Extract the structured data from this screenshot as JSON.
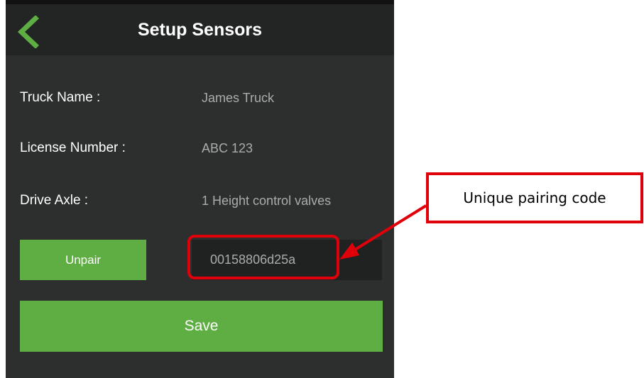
{
  "header": {
    "title": "Setup Sensors",
    "back_icon": "chevron-left-icon"
  },
  "fields": [
    {
      "label": "Truck Name :",
      "value": "James Truck"
    },
    {
      "label": "License Number :",
      "value": "ABC 123"
    },
    {
      "label": "Drive Axle :",
      "value": "1 Height control valves"
    }
  ],
  "pairing": {
    "unpair_label": "Unpair",
    "code": "00158806d25a"
  },
  "actions": {
    "save_label": "Save"
  },
  "annotation": {
    "callout_text": "Unique pairing code"
  },
  "colors": {
    "accent_green": "#5fae44",
    "background": "#2c2f2e",
    "annotation_red": "#e0000a"
  }
}
